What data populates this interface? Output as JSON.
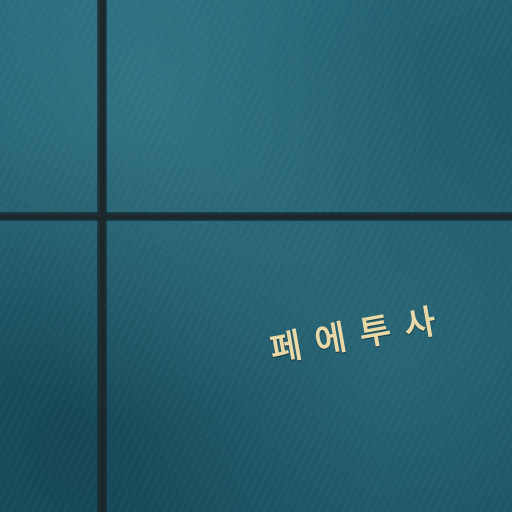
{
  "cover": {
    "title": "페에투사",
    "background_color": "#1f5a6a",
    "text_color": "#e9d8a8",
    "seam_color": "#1e2a2e"
  }
}
